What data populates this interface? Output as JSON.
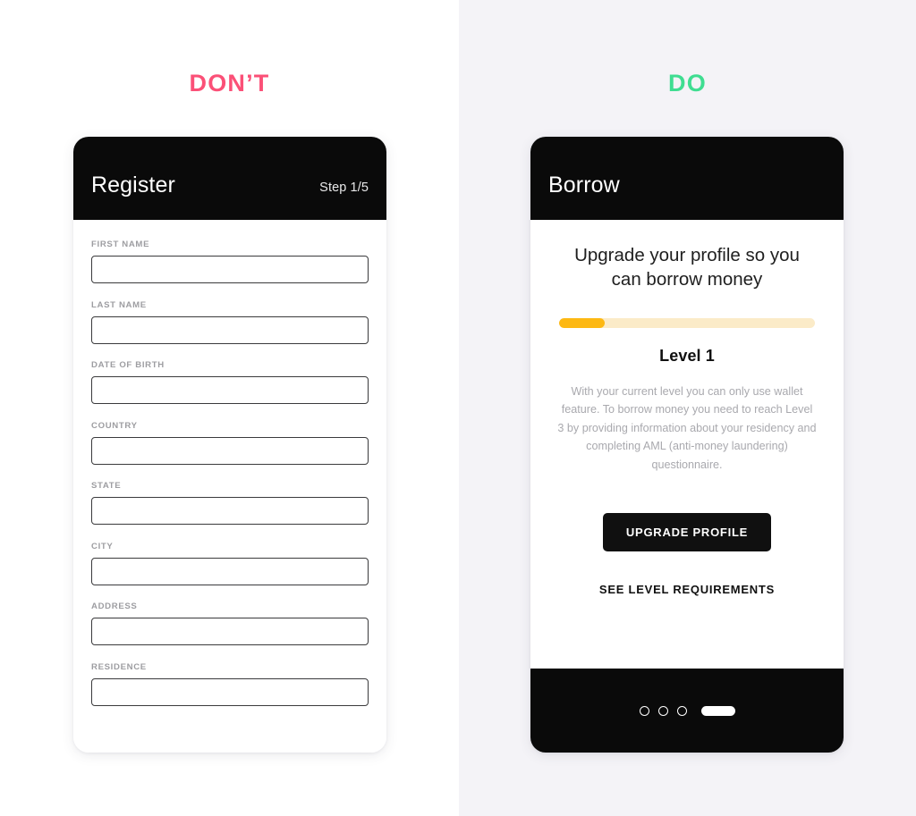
{
  "theme": {
    "bg_left": "#ffffff",
    "bg_right": "#f4f3f7",
    "dont_color": "#fb5077",
    "do_color": "#3fdd91",
    "card_header_bg": "#0a0a0a",
    "progress_fill": "#fdb813",
    "progress_track": "#fbebc8",
    "label_color": "#9d9da1",
    "body_text_color": "#a9a9ae"
  },
  "left": {
    "verdict": "DON’T",
    "header": {
      "title": "Register",
      "step": "Step 1/5"
    },
    "fields": [
      {
        "label": "FIRST NAME",
        "value": "",
        "placeholder": ""
      },
      {
        "label": "LAST NAME",
        "value": "",
        "placeholder": ""
      },
      {
        "label": "DATE OF BIRTH",
        "value": "",
        "placeholder": ""
      },
      {
        "label": "COUNTRY",
        "value": "",
        "placeholder": ""
      },
      {
        "label": "STATE",
        "value": "",
        "placeholder": ""
      },
      {
        "label": "CITY",
        "value": "",
        "placeholder": ""
      },
      {
        "label": "ADDRESS",
        "value": "",
        "placeholder": ""
      },
      {
        "label": "RESIDENCE",
        "value": "",
        "placeholder": ""
      }
    ]
  },
  "right": {
    "verdict": "DO",
    "header": {
      "title": "Borrow"
    },
    "heading": "Upgrade your profile so you can borrow money",
    "progress": {
      "percent": 18,
      "level_label": "Level 1"
    },
    "description": "With your current level you can only use wallet feature. To borrow money you need to reach Level 3 by providing information about your residency and completing AML (anti-money laundering) questionnaire.",
    "primary_button": "UPGRADE PROFILE",
    "secondary_link": "SEE LEVEL REQUIREMENTS",
    "footer": {
      "dots": 3,
      "active_pill": true
    }
  }
}
